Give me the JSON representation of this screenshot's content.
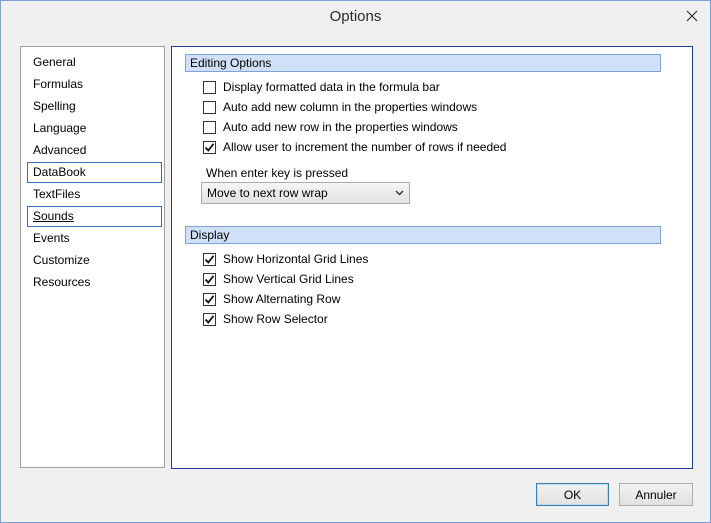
{
  "window": {
    "title": "Options"
  },
  "sidebar": {
    "items": [
      {
        "label": "General"
      },
      {
        "label": "Formulas"
      },
      {
        "label": "Spelling"
      },
      {
        "label": "Language"
      },
      {
        "label": "Advanced"
      },
      {
        "label": "DataBook"
      },
      {
        "label": "TextFiles"
      },
      {
        "label": "Sounds"
      },
      {
        "label": "Events"
      },
      {
        "label": "Customize"
      },
      {
        "label": "Resources"
      }
    ],
    "selected_item": "DataBook",
    "focused_item": "Sounds"
  },
  "editing": {
    "header": "Editing Options",
    "options": [
      {
        "label": "Display formatted data in the formula bar",
        "checked": false
      },
      {
        "label": "Auto add new column in the properties windows",
        "checked": false
      },
      {
        "label": "Auto add new row in the properties windows",
        "checked": false
      },
      {
        "label": "Allow user to increment the number of rows if needed",
        "checked": true
      }
    ],
    "enter_key_label": "When enter key is pressed",
    "enter_key_value": "Move to next row wrap"
  },
  "display": {
    "header": "Display",
    "options": [
      {
        "label": "Show Horizontal Grid Lines",
        "checked": true
      },
      {
        "label": "Show Vertical Grid Lines",
        "checked": true
      },
      {
        "label": "Show Alternating Row",
        "checked": true
      },
      {
        "label": "Show Row Selector",
        "checked": true
      }
    ]
  },
  "buttons": {
    "ok": "OK",
    "cancel": "Annuler"
  },
  "colors": {
    "accent": "#3a6bc4",
    "header_bg": "#cfe0f7",
    "panel_border": "#1f3e9c"
  }
}
